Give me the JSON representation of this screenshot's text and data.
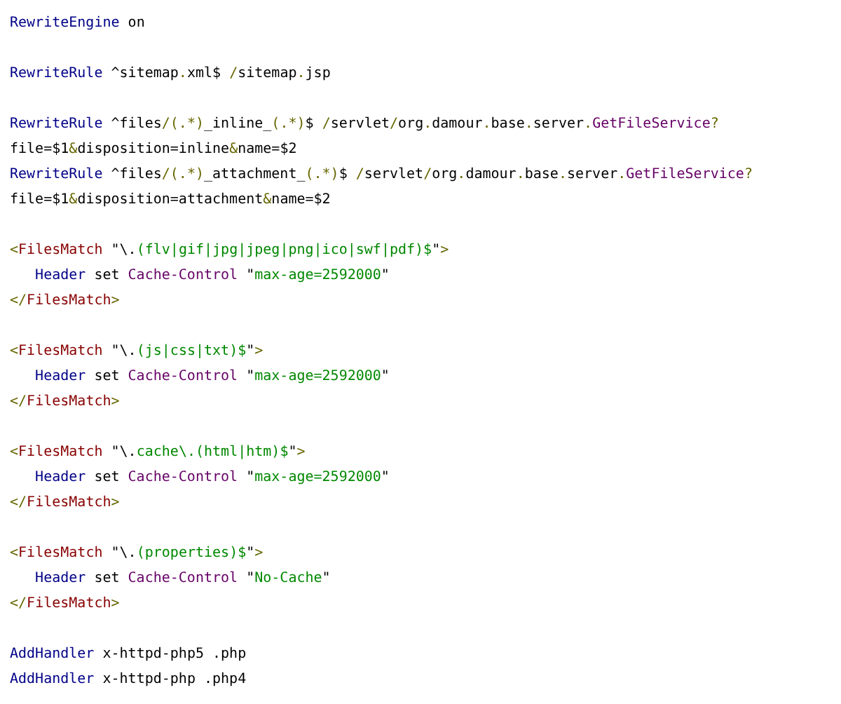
{
  "code_blocks": [
    {
      "lines": [
        [
          {
            "kind": "directive",
            "text": "RewriteEngine"
          },
          {
            "kind": "plain",
            "text": " on"
          }
        ]
      ]
    },
    {
      "lines": [
        [
          {
            "kind": "directive",
            "text": "RewriteRule"
          },
          {
            "kind": "plain",
            "text": " ^sitemap"
          },
          {
            "kind": "punct",
            "text": "."
          },
          {
            "kind": "plain",
            "text": "xml$ "
          },
          {
            "kind": "punct",
            "text": "/"
          },
          {
            "kind": "plain",
            "text": "sitemap"
          },
          {
            "kind": "punct",
            "text": "."
          },
          {
            "kind": "plain",
            "text": "jsp"
          }
        ]
      ]
    },
    {
      "lines": [
        [
          {
            "kind": "directive",
            "text": "RewriteRule"
          },
          {
            "kind": "plain",
            "text": " ^files"
          },
          {
            "kind": "punct",
            "text": "/(.*)"
          },
          {
            "kind": "plain",
            "text": "_inline_"
          },
          {
            "kind": "punct",
            "text": "(.*)"
          },
          {
            "kind": "plain",
            "text": "$ "
          },
          {
            "kind": "punct",
            "text": "/"
          },
          {
            "kind": "plain",
            "text": "servlet"
          },
          {
            "kind": "punct",
            "text": "/"
          },
          {
            "kind": "plain",
            "text": "org"
          },
          {
            "kind": "punct",
            "text": "."
          },
          {
            "kind": "plain",
            "text": "damour"
          },
          {
            "kind": "punct",
            "text": "."
          },
          {
            "kind": "plain",
            "text": "base"
          },
          {
            "kind": "punct",
            "text": "."
          },
          {
            "kind": "plain",
            "text": "server"
          },
          {
            "kind": "punct",
            "text": "."
          },
          {
            "kind": "class",
            "text": "GetFileService"
          },
          {
            "kind": "punct",
            "text": "?"
          }
        ],
        [
          {
            "kind": "plain",
            "text": "file=$1"
          },
          {
            "kind": "punct",
            "text": "&"
          },
          {
            "kind": "plain",
            "text": "disposition=inline"
          },
          {
            "kind": "punct",
            "text": "&"
          },
          {
            "kind": "plain",
            "text": "name=$2"
          }
        ],
        [
          {
            "kind": "directive",
            "text": "RewriteRule"
          },
          {
            "kind": "plain",
            "text": " ^files"
          },
          {
            "kind": "punct",
            "text": "/(.*)"
          },
          {
            "kind": "plain",
            "text": "_attachment_"
          },
          {
            "kind": "punct",
            "text": "(.*)"
          },
          {
            "kind": "plain",
            "text": "$ "
          },
          {
            "kind": "punct",
            "text": "/"
          },
          {
            "kind": "plain",
            "text": "servlet"
          },
          {
            "kind": "punct",
            "text": "/"
          },
          {
            "kind": "plain",
            "text": "org"
          },
          {
            "kind": "punct",
            "text": "."
          },
          {
            "kind": "plain",
            "text": "damour"
          },
          {
            "kind": "punct",
            "text": "."
          },
          {
            "kind": "plain",
            "text": "base"
          },
          {
            "kind": "punct",
            "text": "."
          },
          {
            "kind": "plain",
            "text": "server"
          },
          {
            "kind": "punct",
            "text": "."
          },
          {
            "kind": "class",
            "text": "GetFileService"
          },
          {
            "kind": "punct",
            "text": "?"
          }
        ],
        [
          {
            "kind": "plain",
            "text": "file=$1"
          },
          {
            "kind": "punct",
            "text": "&"
          },
          {
            "kind": "plain",
            "text": "disposition=attachment"
          },
          {
            "kind": "punct",
            "text": "&"
          },
          {
            "kind": "plain",
            "text": "name=$2"
          }
        ]
      ]
    },
    {
      "lines": [
        [
          {
            "kind": "punct",
            "text": "<"
          },
          {
            "kind": "tag",
            "text": "FilesMatch"
          },
          {
            "kind": "plain",
            "text": " \"\\."
          },
          {
            "kind": "string",
            "text": "(flv|gif|jpg|jpeg|png|ico|swf|pdf)$"
          },
          {
            "kind": "plain",
            "text": "\""
          },
          {
            "kind": "punct",
            "text": ">"
          }
        ],
        [
          {
            "kind": "indent"
          },
          {
            "kind": "directive",
            "text": "Header"
          },
          {
            "kind": "plain",
            "text": " set "
          },
          {
            "kind": "class",
            "text": "Cache-Control"
          },
          {
            "kind": "plain",
            "text": " \""
          },
          {
            "kind": "string",
            "text": "max-age=2592000"
          },
          {
            "kind": "plain",
            "text": "\""
          }
        ],
        [
          {
            "kind": "punct",
            "text": "</"
          },
          {
            "kind": "tag",
            "text": "FilesMatch"
          },
          {
            "kind": "punct",
            "text": ">"
          }
        ]
      ]
    },
    {
      "lines": [
        [
          {
            "kind": "punct",
            "text": "<"
          },
          {
            "kind": "tag",
            "text": "FilesMatch"
          },
          {
            "kind": "plain",
            "text": " \"\\."
          },
          {
            "kind": "string",
            "text": "(js|css|txt)$"
          },
          {
            "kind": "plain",
            "text": "\""
          },
          {
            "kind": "punct",
            "text": ">"
          }
        ],
        [
          {
            "kind": "indent"
          },
          {
            "kind": "directive",
            "text": "Header"
          },
          {
            "kind": "plain",
            "text": " set "
          },
          {
            "kind": "class",
            "text": "Cache-Control"
          },
          {
            "kind": "plain",
            "text": " \""
          },
          {
            "kind": "string",
            "text": "max-age=2592000"
          },
          {
            "kind": "plain",
            "text": "\""
          }
        ],
        [
          {
            "kind": "punct",
            "text": "</"
          },
          {
            "kind": "tag",
            "text": "FilesMatch"
          },
          {
            "kind": "punct",
            "text": ">"
          }
        ]
      ]
    },
    {
      "lines": [
        [
          {
            "kind": "punct",
            "text": "<"
          },
          {
            "kind": "tag",
            "text": "FilesMatch"
          },
          {
            "kind": "plain",
            "text": " \"\\."
          },
          {
            "kind": "string",
            "text": "cache\\.(html|htm)$"
          },
          {
            "kind": "plain",
            "text": "\""
          },
          {
            "kind": "punct",
            "text": ">"
          }
        ],
        [
          {
            "kind": "indent"
          },
          {
            "kind": "directive",
            "text": "Header"
          },
          {
            "kind": "plain",
            "text": " set "
          },
          {
            "kind": "class",
            "text": "Cache-Control"
          },
          {
            "kind": "plain",
            "text": " \""
          },
          {
            "kind": "string",
            "text": "max-age=2592000"
          },
          {
            "kind": "plain",
            "text": "\""
          }
        ],
        [
          {
            "kind": "punct",
            "text": "</"
          },
          {
            "kind": "tag",
            "text": "FilesMatch"
          },
          {
            "kind": "punct",
            "text": ">"
          }
        ]
      ]
    },
    {
      "lines": [
        [
          {
            "kind": "punct",
            "text": "<"
          },
          {
            "kind": "tag",
            "text": "FilesMatch"
          },
          {
            "kind": "plain",
            "text": " \"\\."
          },
          {
            "kind": "string",
            "text": "(properties)$"
          },
          {
            "kind": "plain",
            "text": "\""
          },
          {
            "kind": "punct",
            "text": ">"
          }
        ],
        [
          {
            "kind": "indent"
          },
          {
            "kind": "directive",
            "text": "Header"
          },
          {
            "kind": "plain",
            "text": " set "
          },
          {
            "kind": "class",
            "text": "Cache-Control"
          },
          {
            "kind": "plain",
            "text": " \""
          },
          {
            "kind": "string",
            "text": "No-Cache"
          },
          {
            "kind": "plain",
            "text": "\""
          }
        ],
        [
          {
            "kind": "punct",
            "text": "</"
          },
          {
            "kind": "tag",
            "text": "FilesMatch"
          },
          {
            "kind": "punct",
            "text": ">"
          }
        ]
      ]
    },
    {
      "lines": [
        [
          {
            "kind": "directive",
            "text": "AddHandler"
          },
          {
            "kind": "plain",
            "text": " x-httpd-php5 .php"
          }
        ],
        [
          {
            "kind": "directive",
            "text": "AddHandler"
          },
          {
            "kind": "plain",
            "text": " x-httpd-php .php4"
          }
        ]
      ]
    }
  ]
}
